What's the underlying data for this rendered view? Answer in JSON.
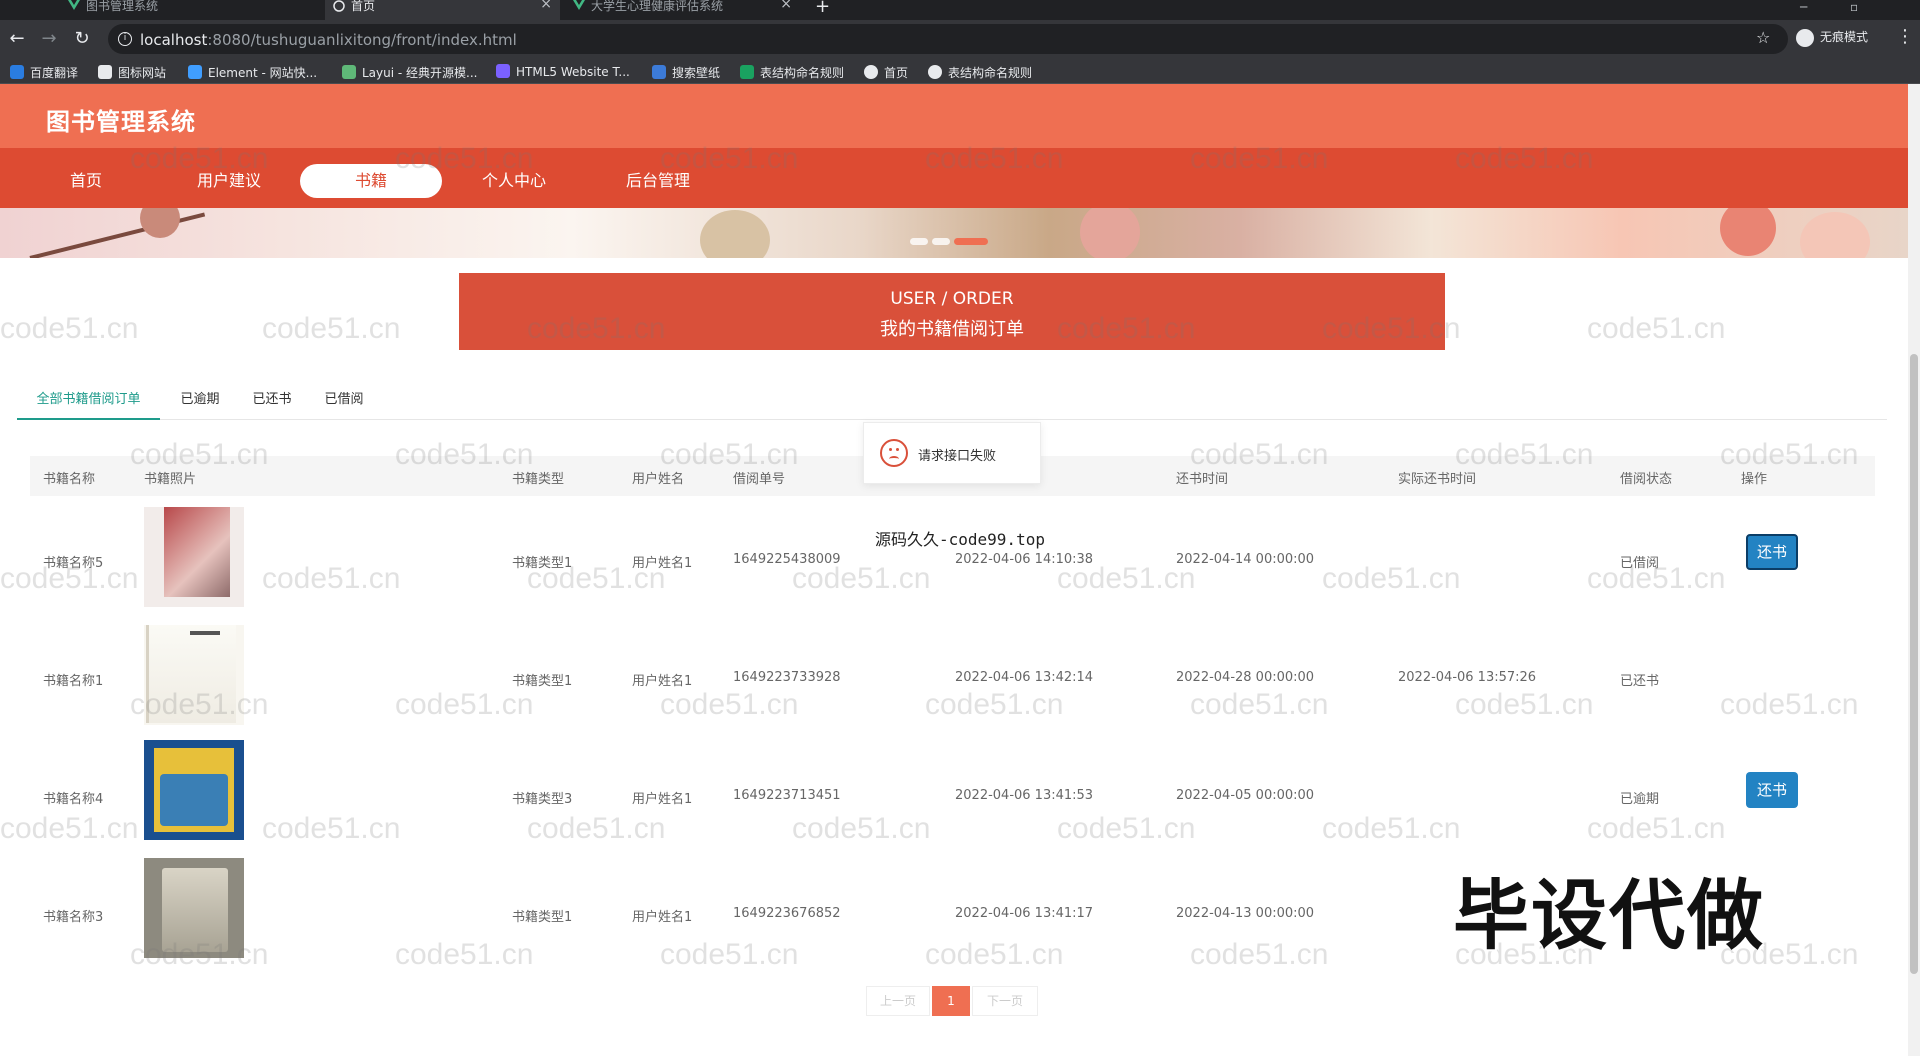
{
  "browser": {
    "tabs": [
      {
        "title": "图书管理系统",
        "active": false
      },
      {
        "title": "首页",
        "active": true
      },
      {
        "title": "大学生心理健康评估系统",
        "active": false
      }
    ],
    "url_host": "localhost",
    "url_rest": ":8080/tushuguanlixitong/front/index.html",
    "incognito_label": "无痕模式",
    "bookmarks": [
      "百度翻译",
      "图标网站",
      "Element - 网站快...",
      "Layui - 经典开源模...",
      "HTML5 Website T...",
      "搜索壁纸",
      "表结构命名规则",
      "首页",
      "表结构命名规则"
    ]
  },
  "site": {
    "title": "图书管理系统",
    "nav": [
      {
        "label": "首页",
        "active": false
      },
      {
        "label": "用户建议",
        "active": false
      },
      {
        "label": "书籍",
        "active": true
      },
      {
        "label": "个人中心",
        "active": false
      },
      {
        "label": "后台管理",
        "active": false
      }
    ]
  },
  "section": {
    "title_en": "USER / ORDER",
    "title_cn": "我的书籍借阅订单"
  },
  "order_tabs": [
    {
      "label": "全部书籍借阅订单",
      "active": true
    },
    {
      "label": "已逾期",
      "active": false
    },
    {
      "label": "已还书",
      "active": false
    },
    {
      "label": "已借阅",
      "active": false
    }
  ],
  "table": {
    "headers": [
      "书籍名称",
      "书籍照片",
      "书籍类型",
      "用户姓名",
      "借阅单号",
      "",
      "还书时间",
      "实际还书时间",
      "借阅状态",
      "操作"
    ],
    "rows": [
      {
        "name": "书籍名称5",
        "type": "书籍类型1",
        "user": "用户姓名1",
        "order_no": "1649225438009",
        "borrow_time": "2022-04-06 14:10:38",
        "due_time": "2022-04-14 00:00:00",
        "actual_return": "",
        "status": "已借阅",
        "action": "还书"
      },
      {
        "name": "书籍名称1",
        "type": "书籍类型1",
        "user": "用户姓名1",
        "order_no": "1649223733928",
        "borrow_time": "2022-04-06 13:42:14",
        "due_time": "2022-04-28 00:00:00",
        "actual_return": "2022-04-06 13:57:26",
        "status": "已还书",
        "action": ""
      },
      {
        "name": "书籍名称4",
        "type": "书籍类型3",
        "user": "用户姓名1",
        "order_no": "1649223713451",
        "borrow_time": "2022-04-06 13:41:53",
        "due_time": "2022-04-05 00:00:00",
        "actual_return": "",
        "status": "已逾期",
        "action": "还书"
      },
      {
        "name": "书籍名称3",
        "type": "书籍类型1",
        "user": "用户姓名1",
        "order_no": "1649223676852",
        "borrow_time": "2022-04-06 13:41:17",
        "due_time": "2022-04-13 00:00:00",
        "actual_return": "",
        "status": "",
        "action": ""
      }
    ]
  },
  "toast": {
    "message": "请求接口失败"
  },
  "overlays": {
    "source_text": "源码久久-code99.top",
    "big_watermark": "毕设代做",
    "watermark": "code51.cn"
  },
  "pager": {
    "prev": "上一页",
    "current": "1",
    "next": "下一页"
  },
  "colors": {
    "header": "#ef6f52",
    "nav": "#dd4b32",
    "accent_tab": "#1e9b8b",
    "button": "#2383c3"
  }
}
